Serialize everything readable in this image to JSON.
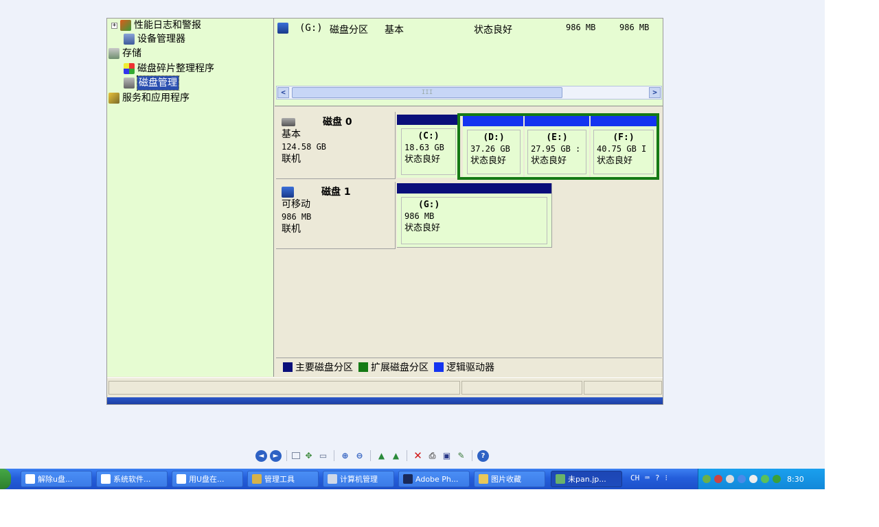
{
  "tree": {
    "items": [
      {
        "label": "性能日志和警报",
        "icon": "performance-logs-icon"
      },
      {
        "label": "设备管理器",
        "icon": "device-manager-icon"
      },
      {
        "label": "存储",
        "icon": "storage-icon"
      },
      {
        "label": "磁盘碎片整理程序",
        "icon": "defrag-icon"
      },
      {
        "label": "磁盘管理",
        "icon": "disk-management-icon",
        "selected": true
      },
      {
        "label": "服务和应用程序",
        "icon": "services-icon"
      }
    ],
    "expand_symbol": "+"
  },
  "volume_row": {
    "name": "(G:)",
    "layout": "磁盘分区",
    "type": "基本",
    "status": "状态良好",
    "capacity": "986 MB",
    "free": "986 MB"
  },
  "scrollbar": {
    "left": "<",
    "right": ">",
    "thumb": "III"
  },
  "disks": [
    {
      "title": "磁盘 0",
      "type": "基本",
      "size": "124.58 GB",
      "state": "联机",
      "partitions": [
        {
          "letter": "(C:)",
          "size": "18.63 GB",
          "status": "状态良好"
        },
        {
          "letter": "(D:)",
          "size": "37.26 GB",
          "status": "状态良好"
        },
        {
          "letter": "(E:)",
          "size": "27.95 GB :",
          "status": "状态良好"
        },
        {
          "letter": "(F:)",
          "size": "40.75 GB I",
          "status": "状态良好"
        }
      ]
    },
    {
      "title": "磁盘 1",
      "type": "可移动",
      "size": "986 MB",
      "state": "联机",
      "partitions": [
        {
          "letter": "(G:)",
          "size": "986 MB",
          "status": "状态良好"
        }
      ]
    }
  ],
  "legend": [
    {
      "label": "主要磁盘分区",
      "color": "#0a0f7a"
    },
    {
      "label": "扩展磁盘分区",
      "color": "#157a15"
    },
    {
      "label": "逻辑驱动器",
      "color": "#1434f0"
    }
  ],
  "viewer_toolbar": {
    "prev": "◄",
    "next": "►",
    "icons": [
      "prev-image-icon",
      "next-image-icon",
      "best-fit-icon",
      "actual-size-icon",
      "slideshow-icon",
      "zoom-in-icon",
      "zoom-out-icon",
      "rotate-cw-icon",
      "rotate-ccw-icon",
      "delete-icon",
      "print-icon",
      "save-icon",
      "edit-icon",
      "help-icon"
    ]
  },
  "taskbar": {
    "buttons": [
      {
        "label": "解除u盘..."
      },
      {
        "label": "系统软件..."
      },
      {
        "label": "用U盘在..."
      },
      {
        "label": "管理工具"
      },
      {
        "label": "计算机管理"
      },
      {
        "label": "Adobe Ph..."
      },
      {
        "label": "图片收藏"
      },
      {
        "label": "未pan.jp...",
        "active": true
      }
    ],
    "language": "CH",
    "clock": "8:30"
  }
}
